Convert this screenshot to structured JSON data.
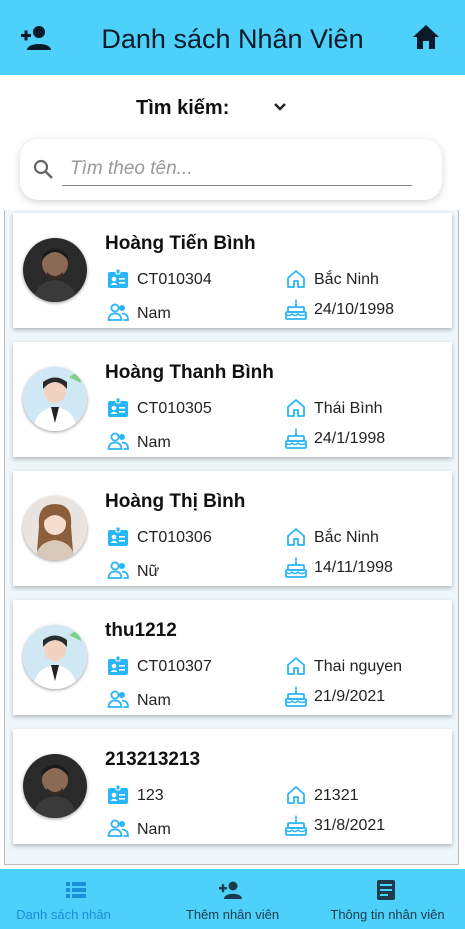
{
  "appbar": {
    "title": "Danh sách Nhân Viên",
    "left_icon": "person-add-icon",
    "right_icon": "home-icon"
  },
  "search": {
    "label": "Tìm kiếm:",
    "placeholder": "Tìm theo tên...",
    "value": ""
  },
  "colors": {
    "primary": "#4dd0f9",
    "icon_blue": "#29b6f6",
    "nav_active": "#1a8fd8"
  },
  "employees": [
    {
      "name": "Hoàng Tiến Bình",
      "code": "CT010304",
      "gender": "Nam",
      "hometown": "Bắc Ninh",
      "dob": "24/10/1998",
      "avatar": "male-dark"
    },
    {
      "name": "Hoàng Thanh Bình",
      "code": "CT010305",
      "gender": "Nam",
      "hometown": "Thái Bình",
      "dob": "24/1/1998",
      "avatar": "male-light"
    },
    {
      "name": "Hoàng Thị Bình",
      "code": "CT010306",
      "gender": "Nữ",
      "hometown": "Bắc Ninh",
      "dob": "14/11/1998",
      "avatar": "female"
    },
    {
      "name": "thu1212",
      "code": "CT010307",
      "gender": "Nam",
      "hometown": "Thai nguyen",
      "dob": "21/9/2021",
      "avatar": "male-light"
    },
    {
      "name": "213213213",
      "code": "123",
      "gender": "Nam",
      "hometown": "21321",
      "dob": "31/8/2021",
      "avatar": "male-dark"
    }
  ],
  "bottom_nav": [
    {
      "label": "Danh sách nhân",
      "icon": "list-icon",
      "active": true
    },
    {
      "label": "Thêm nhân viên",
      "icon": "person-add-icon",
      "active": false
    },
    {
      "label": "Thông tin nhân viên",
      "icon": "document-icon",
      "active": false
    }
  ]
}
